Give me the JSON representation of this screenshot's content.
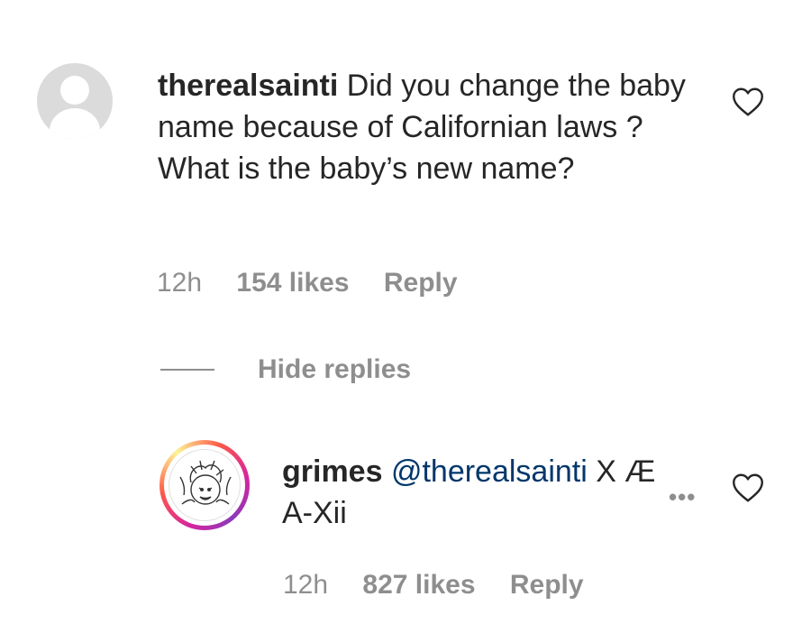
{
  "comment": {
    "username": "therealsainti",
    "text": "Did you change the baby name because of Californian laws ? What is the baby’s new name?",
    "time": "12h",
    "likes": "154 likes",
    "reply_label": "Reply"
  },
  "hide_replies_label": "Hide replies",
  "reply": {
    "username": "grimes",
    "mention": "@therealsainti",
    "text_tail": "X Æ",
    "text_line2": "A-Xii",
    "more_label": "•••",
    "time": "12h",
    "likes": "827 likes",
    "reply_label": "Reply"
  },
  "icons": {
    "like": "heart-icon",
    "default_avatar": "default-avatar-icon",
    "more": "more-options-icon"
  },
  "colors": {
    "text": "#262626",
    "secondary": "#8e8e8e",
    "mention": "#00376b"
  }
}
